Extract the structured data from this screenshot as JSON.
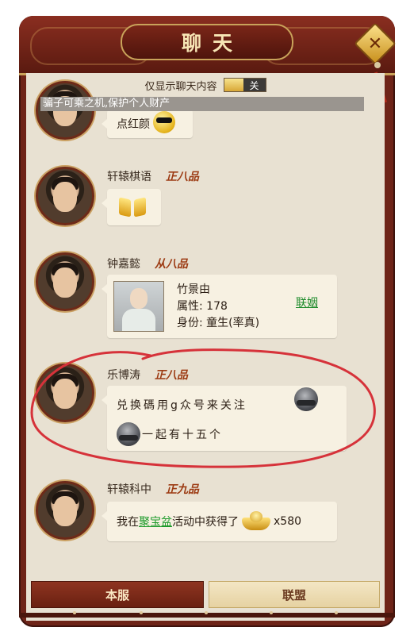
{
  "header": {
    "title": "聊天",
    "close_symbol": "✕"
  },
  "filter": {
    "label": "仅显示聊天内容",
    "toggle_state": "关"
  },
  "warning": "骗子可乘之机,保护个人财产",
  "messages": [
    {
      "text": "点红颜",
      "emoji": "cool-face-emoji"
    },
    {
      "name": "轩辕棋语",
      "rank": "正八品",
      "emoji": "gold-bows-emoji"
    },
    {
      "name": "钟嘉懿",
      "rank": "从八品",
      "card": {
        "name": "竹景由",
        "attr": "属性: 178",
        "identity": "身份: 童生(率真)",
        "action": "联姻"
      }
    },
    {
      "name": "乐博涛",
      "rank": "正八品",
      "line1": "兑换碼用g众号来关注",
      "line2": "一起有十五个"
    },
    {
      "name": "轩辕科中",
      "rank": "正九品",
      "prefix": "我在",
      "link": "聚宝盆",
      "suffix": "活动中获得了",
      "amount": "x580"
    }
  ],
  "tabs": {
    "server": "本服",
    "alliance": "联盟"
  },
  "colors": {
    "frame": "#6e2418",
    "paper": "#e8e1d2",
    "rank": "#9c3a12",
    "link": "#1c9a2a",
    "annotation": "#d6323a"
  }
}
